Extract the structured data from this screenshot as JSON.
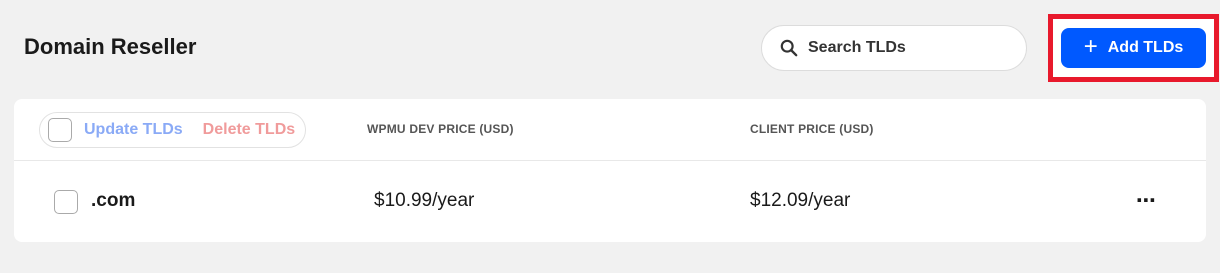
{
  "header": {
    "title": "Domain Reseller",
    "search_placeholder": "Search TLDs",
    "add_button_label": "Add TLDs"
  },
  "table": {
    "bulk_actions": {
      "update_label": "Update TLDs",
      "delete_label": "Delete TLDs"
    },
    "columns": [
      "WPMU DEV PRICE (USD)",
      "CLIENT PRICE (USD)"
    ],
    "rows": [
      {
        "tld": ".com",
        "wpmu_price": "$10.99/year",
        "client_price": "$12.09/year"
      }
    ]
  },
  "icons": {
    "search": "search-icon",
    "add": "plus-icon",
    "more": "more-options-icon"
  },
  "colors": {
    "primary": "#0059ff",
    "highlight": "#e8192c",
    "update_text": "#8aaaf6",
    "delete_text": "#f09b9b"
  }
}
